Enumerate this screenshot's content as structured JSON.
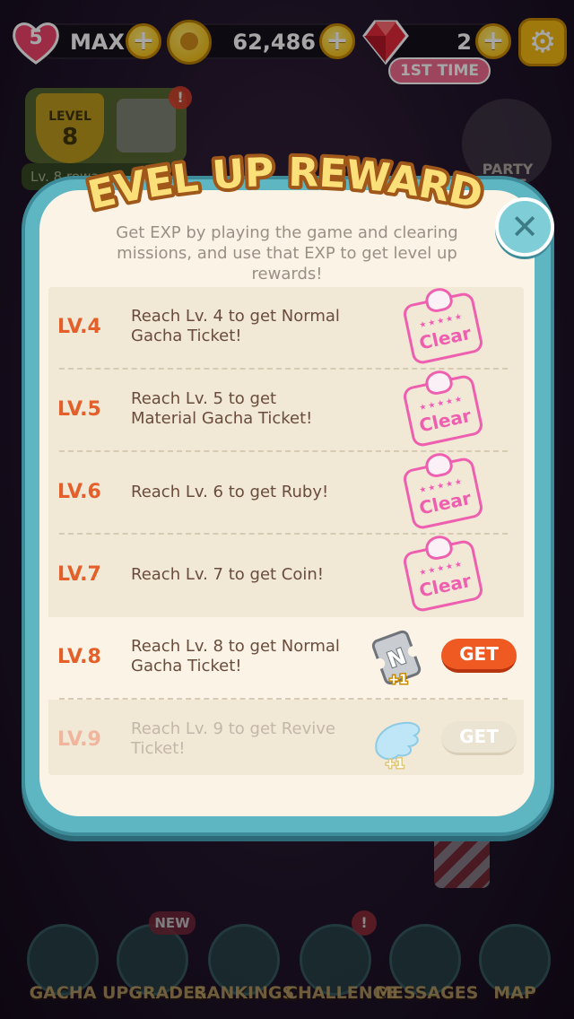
{
  "topbar": {
    "hearts": "5",
    "hearts_label": "MAX",
    "coins": "62,486",
    "rubies": "2",
    "first_time_badge": "1ST TIME"
  },
  "background": {
    "level_badge_label": "LEVEL",
    "level_badge_value": "8",
    "level_rewards_hint": "Lv. 8 rewa",
    "notification": "!",
    "party_time": "PARTY TIME"
  },
  "modal": {
    "title": "LEVEL UP REWARDS",
    "description": "Get EXP by playing the game and clearing missions, and use that EXP to get level up rewards!",
    "rewards": [
      {
        "level": "LV.4",
        "text": "Reach Lv. 4 to get Normal Gacha Ticket!",
        "status": "Clear"
      },
      {
        "level": "LV.5",
        "text": "Reach Lv. 5 to get Material Gacha Ticket!",
        "status": "Clear"
      },
      {
        "level": "LV.6",
        "text": "Reach Lv. 6 to get Ruby!",
        "status": "Clear"
      },
      {
        "level": "LV.7",
        "text": "Reach Lv. 7 to get Coin!",
        "status": "Clear"
      },
      {
        "level": "LV.8",
        "text": "Reach Lv. 8 to get Normal Gacha Ticket!",
        "item_letter": "N",
        "item_count": "+1",
        "button": "GET"
      },
      {
        "level": "LV.9",
        "text": "Reach Lv. 9 to get Revive Ticket!",
        "item_count": "+1",
        "button": "GET"
      }
    ]
  },
  "nav": {
    "items": [
      {
        "label": "GACHA"
      },
      {
        "label": "UPGRADES"
      },
      {
        "label": "RANKINGS"
      },
      {
        "label": "CHALLENGE"
      },
      {
        "label": "MESSAGES"
      },
      {
        "label": "MAP"
      }
    ],
    "new_tag": "NEW",
    "challenge_alert": "!"
  },
  "colors": {
    "accent": "#e4602a",
    "frame": "#5fb6c3",
    "stamp": "#ef5fb0",
    "get_button": "#ef5a22"
  }
}
